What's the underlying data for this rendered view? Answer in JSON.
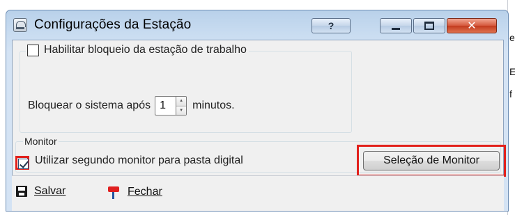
{
  "window": {
    "title": "Configurações da Estação",
    "help_label": "?"
  },
  "lock_group": {
    "checkbox_label": "Habilitar bloqueio da estação de trabalho",
    "checked": false,
    "prefix": "Bloquear o sistema após",
    "minutes_value": "1",
    "suffix": "minutos."
  },
  "monitor_group": {
    "title": "Monitor",
    "checkbox_label": "Utilizar segundo monitor para pasta digital",
    "checked": true,
    "select_button_label": "Seleção de Monitor"
  },
  "footer": {
    "save_label": "Salvar",
    "close_label": "Fechar"
  },
  "background": {
    "letters": [
      "e",
      "E",
      "f"
    ]
  },
  "colors": {
    "highlight": "#e2211c",
    "close_button": "#c23a1e"
  }
}
